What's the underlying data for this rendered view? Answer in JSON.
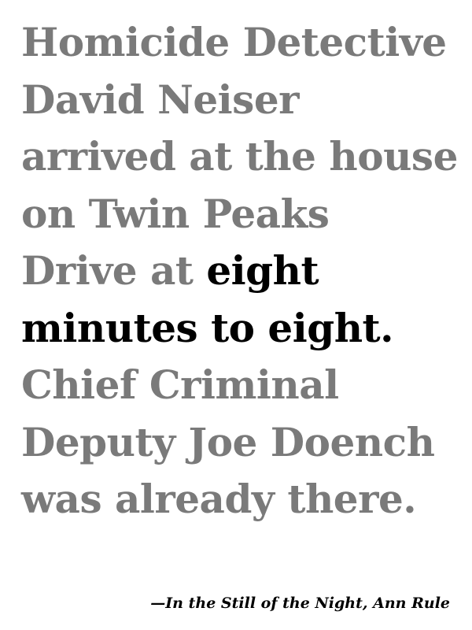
{
  "quote": {
    "lines": [
      {
        "pre": "Homicide Detective",
        "em": ""
      },
      {
        "pre": "David Neiser",
        "em": ""
      },
      {
        "pre": "arrived at the house",
        "em": ""
      },
      {
        "pre": "on Twin Peaks",
        "em": ""
      },
      {
        "pre": "Drive at ",
        "em": "eight"
      },
      {
        "pre": "",
        "em": "minutes to eight."
      },
      {
        "pre": "Chief Criminal",
        "em": ""
      },
      {
        "pre": "Deputy Joe Doench",
        "em": ""
      },
      {
        "pre": "was already there.",
        "em": ""
      }
    ]
  },
  "attribution": "—In the Still of the Night, Ann Rule",
  "colors": {
    "muted_text": "#7a7a7a",
    "emphasis_text": "#000000",
    "background": "#ffffff"
  }
}
